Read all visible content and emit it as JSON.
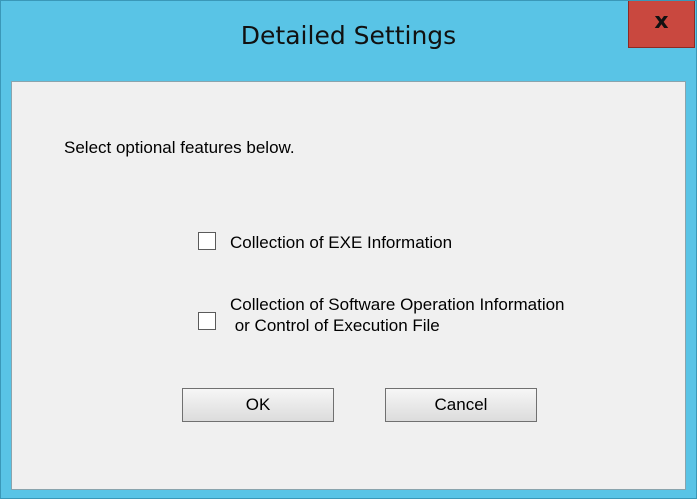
{
  "window": {
    "title": "Detailed Settings",
    "close_label": "x"
  },
  "dialog": {
    "intro": "Select optional features below.",
    "options": [
      {
        "label": "Collection of EXE Information",
        "checked": false
      },
      {
        "label": "Collection of Software Operation Information\n or Control of Execution File",
        "checked": false
      }
    ],
    "ok_label": "OK",
    "cancel_label": "Cancel"
  },
  "colors": {
    "frame": "#59c4e6",
    "close_button": "#c9483f",
    "client_background": "#f0f0f0"
  }
}
